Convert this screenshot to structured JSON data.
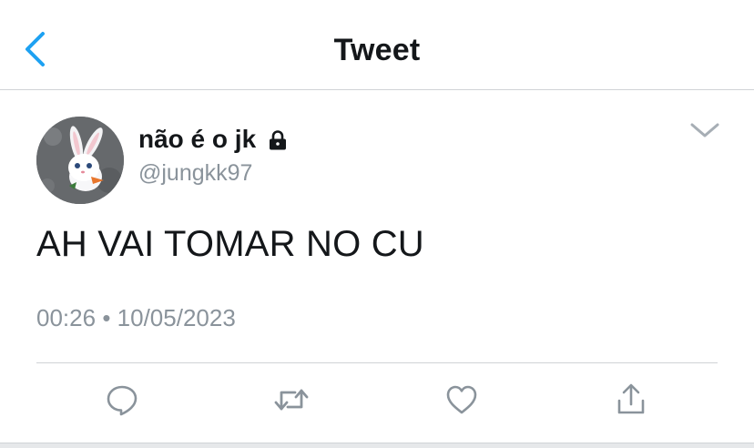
{
  "header": {
    "title": "Tweet",
    "back_icon": "chevron-left-icon"
  },
  "tweet": {
    "author": {
      "display_name": "não é o jk",
      "handle": "@jungkk97",
      "protected_icon": "lock-icon",
      "avatar": "white-bunny-avatar"
    },
    "text": "AH VAI TOMAR NO CU",
    "time": "00:26",
    "separator": "•",
    "date": "10/05/2023",
    "menu_icon": "chevron-down-icon"
  },
  "actions": [
    {
      "name": "reply",
      "icon": "reply-icon"
    },
    {
      "name": "retweet",
      "icon": "retweet-icon"
    },
    {
      "name": "like",
      "icon": "heart-icon"
    },
    {
      "name": "share",
      "icon": "share-icon"
    }
  ],
  "colors": {
    "accent": "#1da1f2",
    "text_primary": "#14171a",
    "text_secondary": "#8a939b",
    "icon": "#8a939b",
    "divider": "#d0d3d6"
  }
}
